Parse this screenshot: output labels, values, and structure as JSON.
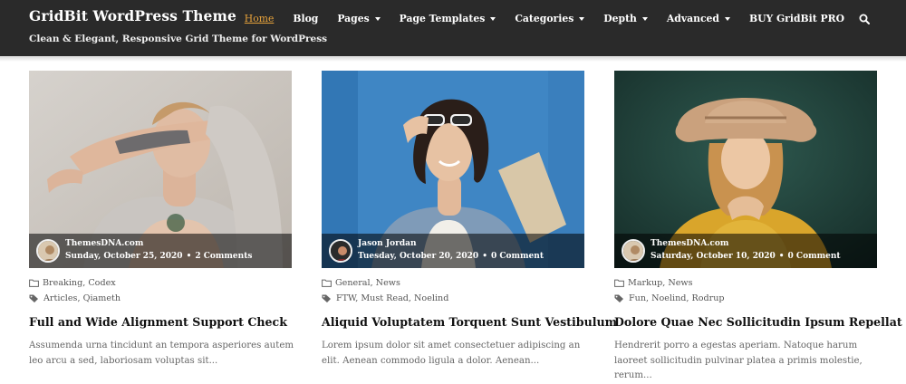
{
  "header": {
    "site_title": "GridBit WordPress Theme",
    "tagline": "Clean & Elegant, Responsive Grid Theme for WordPress",
    "background": "#2a2a2a",
    "accent": "#e8a33b"
  },
  "nav": {
    "items": [
      {
        "label": "Home",
        "active": true
      },
      {
        "label": "Blog"
      },
      {
        "label": "Pages",
        "dropdown": true
      },
      {
        "label": "Page Templates",
        "dropdown": true
      },
      {
        "label": "Categories",
        "dropdown": true
      },
      {
        "label": "Depth",
        "dropdown": true
      },
      {
        "label": "Advanced",
        "dropdown": true
      },
      {
        "label": "BUY GridBit PRO"
      }
    ],
    "search_icon": "search-icon"
  },
  "posts": [
    {
      "author": "ThemesDNA.com",
      "date": "Sunday, October 25, 2020",
      "comments": "2 Comments",
      "categories": "Breaking, Codex",
      "tags": "Articles, Qiameth",
      "title": "Full and Wide Alignment Support Check",
      "excerpt": "Assumenda urna tincidunt an tempora asperiores autem leo arcu a sed, laboriosam voluptas sit..."
    },
    {
      "author": "Jason Jordan",
      "date": "Tuesday, October 20, 2020",
      "comments": "0 Comment",
      "categories": "General, News",
      "tags": "FTW, Must Read, Noelind",
      "title": "Aliquid Voluptatem Torquent Sunt Vestibulum",
      "excerpt": "Lorem ipsum dolor sit amet consectetuer adipiscing an elit. Aenean commodo ligula a dolor. Aenean..."
    },
    {
      "author": "ThemesDNA.com",
      "date": "Saturday, October 10, 2020",
      "comments": "0 Comment",
      "categories": "Markup, News",
      "tags": "Fun, Noelind, Rodrup",
      "title": "Dolore Quae Nec Sollicitudin Ipsum Repellat",
      "excerpt": "Hendrerit porro a egestas aperiam. Natoque harum laoreet sollicitudin pulvinar platea a primis molestie, rerum..."
    }
  ]
}
